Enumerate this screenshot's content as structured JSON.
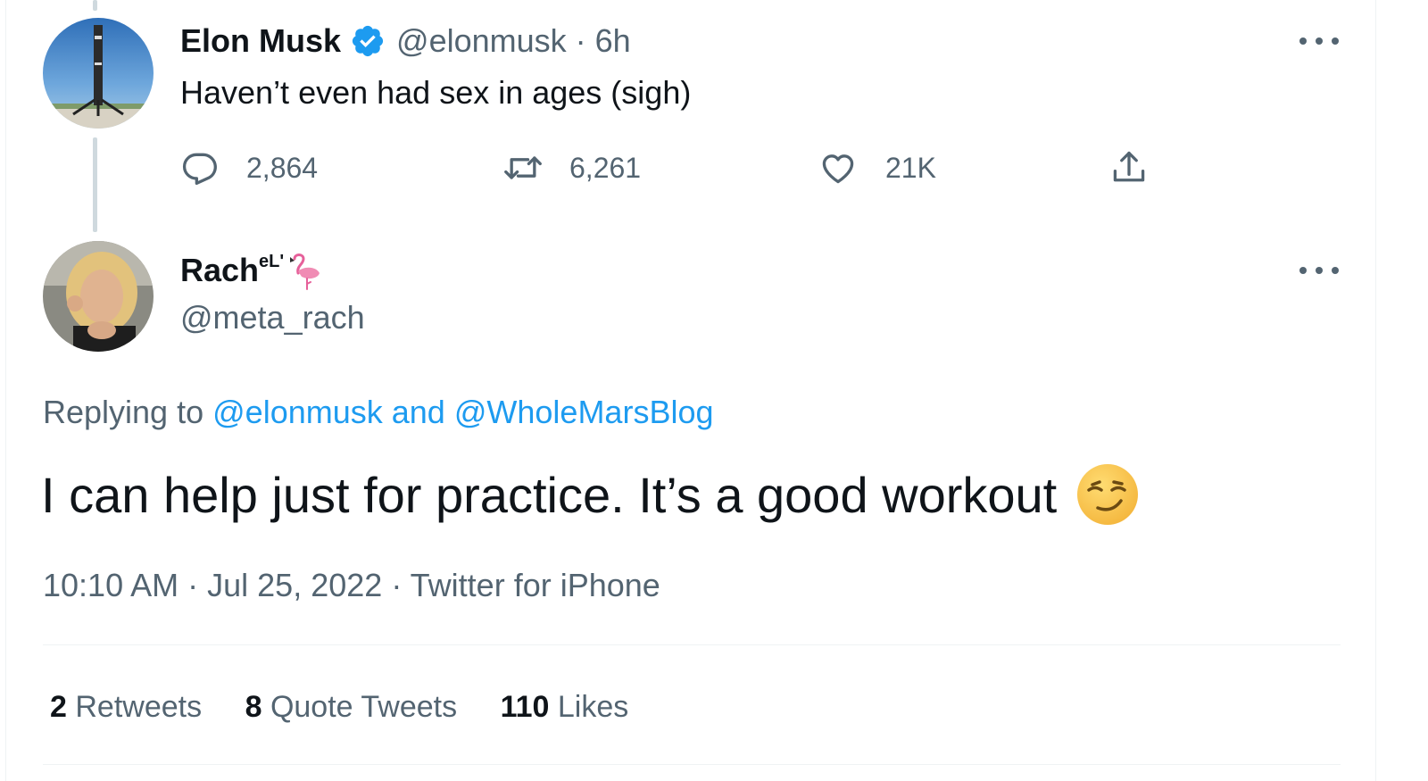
{
  "parent_tweet": {
    "author_name": "Elon Musk",
    "author_handle": "@elonmusk",
    "separator": "·",
    "time_ago": "6h",
    "text": "Haven’t even had sex in ages (sigh)",
    "replies": "2,864",
    "retweets": "6,261",
    "likes": "21K"
  },
  "reply_tweet": {
    "author_name": "Rach",
    "author_name_suffix": "eL'",
    "author_handle": "@meta_rach",
    "replying_prefix": "Replying to",
    "replying_to_1": "@elonmusk",
    "replying_and": "and",
    "replying_to_2": "@WholeMarsBlog",
    "text": "I can help just for practice. It’s a good workout",
    "emoji": "smirking-face",
    "time": "10:10 AM",
    "date": "Jul 25, 2022",
    "source": "Twitter for iPhone",
    "dot": "·"
  },
  "stats": {
    "retweets_count": "2",
    "retweets_label": "Retweets",
    "quotes_count": "8",
    "quotes_label": "Quote Tweets",
    "likes_count": "110",
    "likes_label": "Likes"
  },
  "colors": {
    "accent": "#1d9bf0",
    "text_primary": "#0f1419",
    "text_secondary": "#536471",
    "border": "#eff3f4",
    "verified": "#1d9bf0"
  }
}
